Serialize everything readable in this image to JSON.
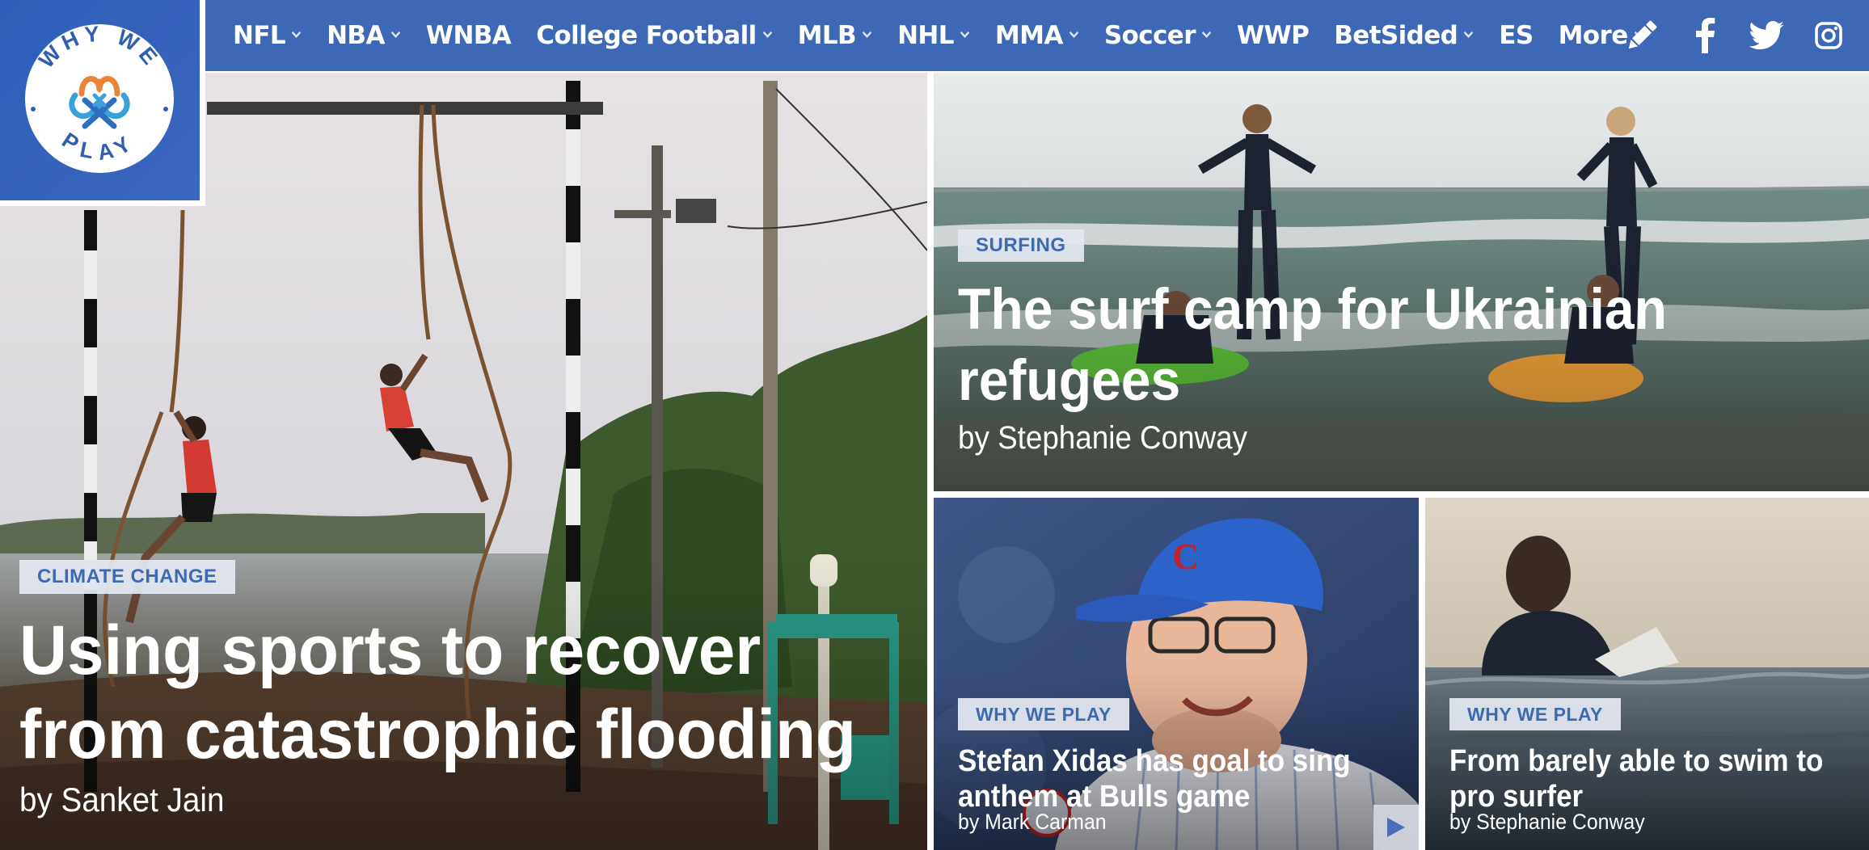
{
  "brand": {
    "name": "Why We Play",
    "logo_words": [
      "WHY",
      "WE",
      "PLAY"
    ],
    "nav_color": "#3c68b6",
    "tag_text_color": "#3e6ab0"
  },
  "nav": {
    "items": [
      {
        "label": "NFL",
        "dropdown": true
      },
      {
        "label": "NBA",
        "dropdown": true
      },
      {
        "label": "WNBA",
        "dropdown": false
      },
      {
        "label": "College Football",
        "dropdown": true
      },
      {
        "label": "MLB",
        "dropdown": true
      },
      {
        "label": "NHL",
        "dropdown": true
      },
      {
        "label": "MMA",
        "dropdown": true
      },
      {
        "label": "Soccer",
        "dropdown": true
      },
      {
        "label": "WWP",
        "dropdown": false
      },
      {
        "label": "BetSided",
        "dropdown": true
      },
      {
        "label": "ES",
        "dropdown": false
      },
      {
        "label": "More",
        "dropdown": true
      }
    ]
  },
  "social": [
    {
      "icon": "pencil-icon"
    },
    {
      "icon": "facebook-icon"
    },
    {
      "icon": "twitter-icon"
    },
    {
      "icon": "instagram-icon"
    }
  ],
  "stories": {
    "flood": {
      "tag": "CLIMATE CHANGE",
      "headline_line1": "Using sports to recover",
      "headline_line2": "from catastrophic flooding",
      "byline": "by Sanket Jain"
    },
    "surf": {
      "tag": "SURFING",
      "headline_line1": "The surf camp for Ukrainian",
      "headline_line2": "refugees",
      "byline": "by Stephanie Conway"
    },
    "stefan": {
      "tag": "WHY WE PLAY",
      "headline_line1": "Stefan Xidas has goal to sing",
      "headline_line2": "anthem at Bulls game",
      "byline": "by Mark Carman"
    },
    "swim": {
      "tag": "WHY WE PLAY",
      "headline_line1": "From barely able to swim to",
      "headline_line2": "pro surfer",
      "byline": "by Stephanie Conway"
    }
  }
}
